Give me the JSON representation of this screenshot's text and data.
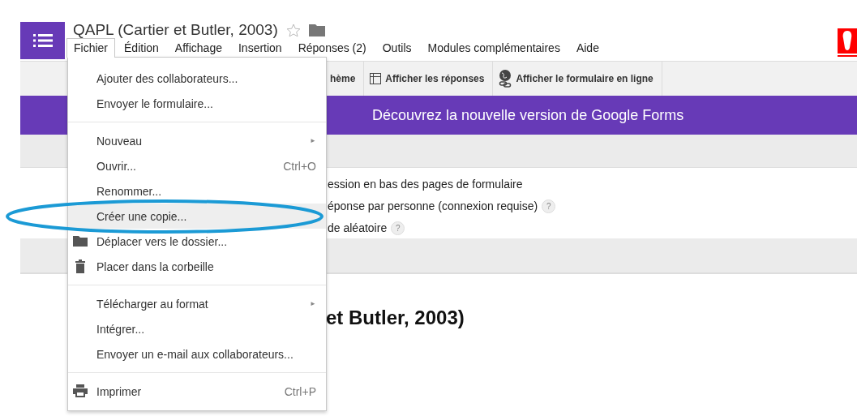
{
  "document": {
    "title": "QAPL (Cartier et Butler, 2003)"
  },
  "menubar": [
    {
      "label": "Fichier",
      "selected": true
    },
    {
      "label": "Édition",
      "selected": false
    },
    {
      "label": "Affichage",
      "selected": false
    },
    {
      "label": "Insertion",
      "selected": false
    },
    {
      "label": "Réponses (2)",
      "selected": false
    },
    {
      "label": "Outils",
      "selected": false
    },
    {
      "label": "Modules complémentaires",
      "selected": false
    },
    {
      "label": "Aide",
      "selected": false
    }
  ],
  "toolbar": [
    {
      "label": "hème",
      "kind": "text"
    },
    {
      "label": "Afficher les réponses",
      "kind": "table"
    },
    {
      "label": "Afficher le formulaire en ligne",
      "kind": "globe"
    }
  ],
  "banner": {
    "text": "Découvrez la nouvelle version de Google Forms"
  },
  "settings": [
    {
      "text": "ession en bas des pages de formulaire"
    },
    {
      "text": "éponse par personne (connexion requise)",
      "help": "?"
    },
    {
      "text": "de aléatoire",
      "help": "?"
    }
  ],
  "form": {
    "title": "et Butler, 2003)"
  },
  "file_menu": {
    "sections": [
      [
        {
          "label": "Ajouter des collaborateurs...",
          "kind": "plain",
          "selected": false
        },
        {
          "label": "Envoyer le formulaire...",
          "kind": "plain",
          "selected": false
        }
      ],
      [
        {
          "label": "Nouveau",
          "kind": "plain",
          "arrow": "►",
          "selected": false
        },
        {
          "label": "Ouvrir...",
          "kind": "plain",
          "shortcut": "Ctrl+O",
          "selected": false
        },
        {
          "label": "Renommer...",
          "kind": "plain",
          "selected": false
        },
        {
          "label": "Créer une copie...",
          "kind": "plain",
          "selected": true
        },
        {
          "label": "Déplacer vers le dossier...",
          "kind": "folder",
          "selected": false
        },
        {
          "label": "Placer dans la corbeille",
          "kind": "trash",
          "selected": false
        }
      ],
      [
        {
          "label": "Télécharger au format",
          "kind": "plain",
          "arrow": "►",
          "selected": false
        },
        {
          "label": "Intégrer...",
          "kind": "plain",
          "selected": false
        },
        {
          "label": "Envoyer un e-mail aux collaborateurs...",
          "kind": "plain",
          "selected": false
        }
      ],
      [
        {
          "label": "Imprimer",
          "kind": "print",
          "shortcut": "Ctrl+P",
          "selected": false
        }
      ]
    ]
  }
}
